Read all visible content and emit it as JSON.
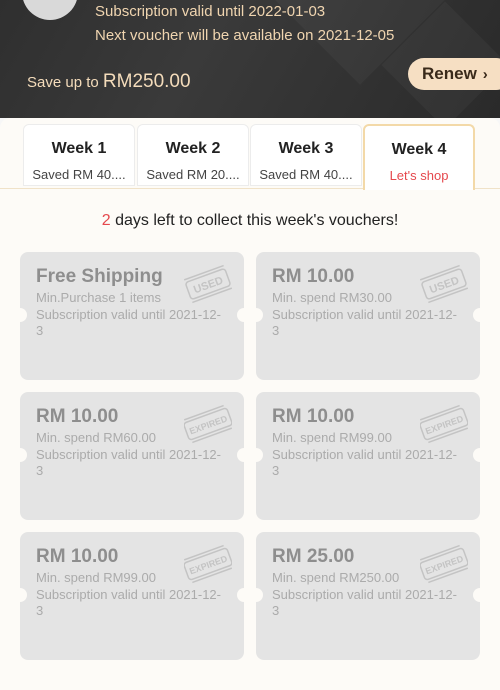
{
  "header": {
    "subscription_valid": "Subscription valid until 2022-01-03",
    "next_voucher": "Next voucher will be available on 2021-12-05",
    "save_prefix": "Save up to ",
    "save_amount": "RM250.00",
    "renew_label": "Renew",
    "renew_chevron": "›"
  },
  "tabs": [
    {
      "title": "Week 1",
      "sub": "Saved RM 40...."
    },
    {
      "title": "Week 2",
      "sub": "Saved RM 20...."
    },
    {
      "title": "Week 3",
      "sub": "Saved RM 40...."
    },
    {
      "title": "Week 4",
      "sub": "Let's shop"
    }
  ],
  "days_left": {
    "count": "2",
    "text": " days left to collect this week's vouchers!"
  },
  "vouchers": [
    {
      "title": "Free Shipping",
      "min": "Min.Purchase 1 items",
      "valid": "Subscription valid until 2021-12-3",
      "stamp": "USED"
    },
    {
      "title": "RM 10.00",
      "min": "Min. spend RM30.00",
      "valid": "Subscription valid until 2021-12-3",
      "stamp": "USED"
    },
    {
      "title": "RM 10.00",
      "min": "Min. spend RM60.00",
      "valid": "Subscription valid until 2021-12-3",
      "stamp": "EXPIRED"
    },
    {
      "title": "RM 10.00",
      "min": "Min. spend RM99.00",
      "valid": "Subscription valid until 2021-12-3",
      "stamp": "EXPIRED"
    },
    {
      "title": "RM 10.00",
      "min": "Min. spend RM99.00",
      "valid": "Subscription valid until 2021-12-3",
      "stamp": "EXPIRED"
    },
    {
      "title": "RM 25.00",
      "min": "Min. spend RM250.00",
      "valid": "Subscription valid until 2021-12-3",
      "stamp": "EXPIRED"
    }
  ],
  "colors": {
    "accent_red": "#e5484d",
    "gold_text": "#f0d5b0",
    "renew_bg": "#f6dfc3",
    "header_bg": "#2f2f2f"
  }
}
